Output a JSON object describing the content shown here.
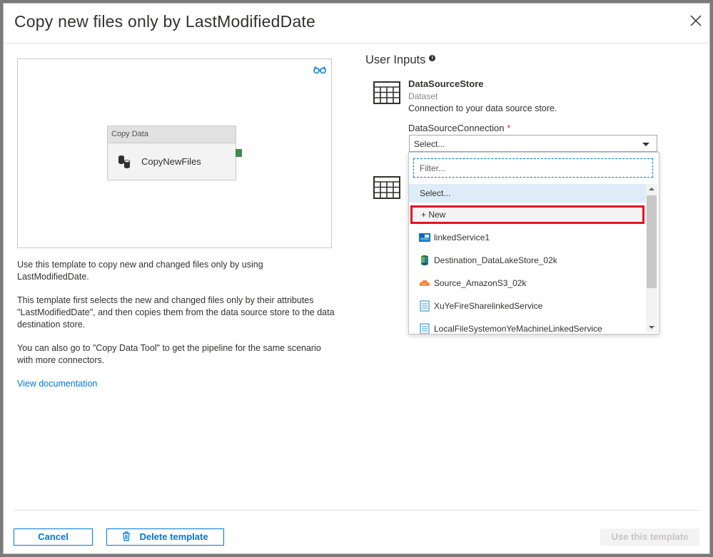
{
  "dialog": {
    "title": "Copy new files only by LastModifiedDate"
  },
  "canvas": {
    "activity_header": "Copy Data",
    "activity_name": "CopyNewFiles"
  },
  "description": {
    "p1": "Use this template to copy new and changed files only by using LastModifiedDate.",
    "p2": "This template first selects the new and changed files only by their attributes \"LastModifiedDate\", and then copies them from the data source store to the data destination store.",
    "p3": "You can also go to \"Copy Data Tool\" to get the pipeline for the same scenario with more connectors.",
    "link": "View documentation"
  },
  "user_inputs": {
    "title": "User Inputs",
    "dataset_name": "DataSourceStore",
    "dataset_type": "Dataset",
    "dataset_desc": "Connection to your data source store.",
    "connection_label": "DataSourceConnection",
    "required_mark": "*",
    "select_value": "Select...",
    "filter_placeholder": "Filter...",
    "options": {
      "select": "Select...",
      "new": "+ New",
      "o1": "linkedService1",
      "o2": "Destination_DataLakeStore_02k",
      "o3": "Source_AmazonS3_02k",
      "o4": "XuYeFireSharelinkedService",
      "o5": "LocalFileSystemonYeMachineLinkedService"
    }
  },
  "footer": {
    "cancel": "Cancel",
    "delete": "Delete template",
    "use": "Use this template"
  },
  "colors": {
    "accent": "#0078d4",
    "highlight_border": "#e81123",
    "connector_green": "#3c8b4a"
  }
}
